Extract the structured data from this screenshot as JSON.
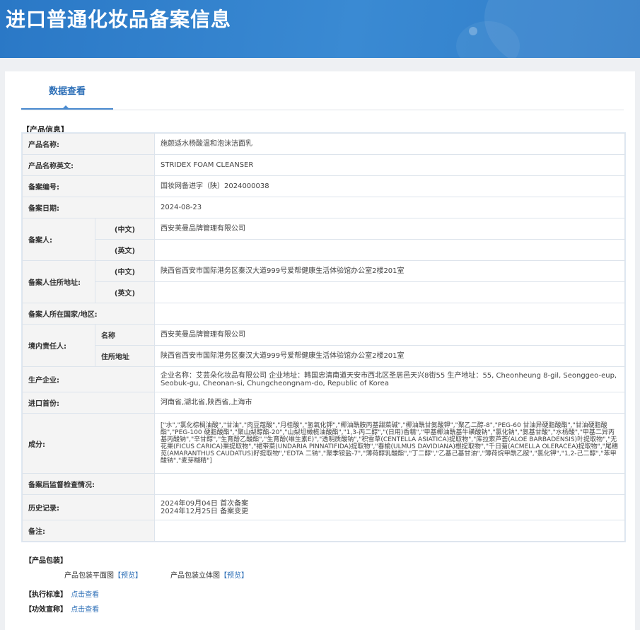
{
  "header": {
    "title": "进口普通化妆品备案信息"
  },
  "tabs": [
    {
      "label": "数据查看"
    }
  ],
  "product_info": {
    "section_title": "【产品信息】",
    "rows": {
      "name": {
        "label": "产品名称:",
        "value": "施颜适水杨酸温和泡沫洁面乳"
      },
      "name_en": {
        "label": "产品名称英文:",
        "value": "STRIDEX FOAM CLEANSER"
      },
      "reg_no": {
        "label": "备案编号:",
        "value": "国妆网备进字（陕）2024000038"
      },
      "reg_date": {
        "label": "备案日期:",
        "value": "2024-08-23"
      },
      "registrant": {
        "label": "备案人:",
        "cn_label": "(中文)",
        "cn_value": "西安芙曼品牌管理有限公司",
        "en_label": "(英文)",
        "en_value": ""
      },
      "registrant_addr": {
        "label": "备案人住所地址:",
        "cn_label": "(中文)",
        "cn_value": "陕西省西安市国际港务区秦汉大道999号爱帮健康生活体验馆办公室2楼201室",
        "en_label": "(英文)",
        "en_value": ""
      },
      "country": {
        "label": "备案人所在国家/地区:",
        "value": ""
      },
      "domestic": {
        "label": "境内责任人:",
        "name_label": "名称",
        "name_value": "西安芙曼品牌管理有限公司",
        "addr_label": "住所地址",
        "addr_value": "陕西省西安市国际港务区秦汉大道999号爱帮健康生活体验馆办公室2楼201室"
      },
      "manufacturer": {
        "label": "生产企业:",
        "value": "企业名称：艾芸朵化妆品有限公司 企业地址：韩国忠清南道天安市西北区圣居邑天兴8街55 生产地址：55, Cheonheung 8-gil, Seonggeo-eup, Seobuk-gu, Cheonan-si, Chungcheongnam-do, Republic of Korea"
      },
      "import_ports": {
        "label": "进口首份:",
        "value": "河南省,湖北省,陕西省,上海市"
      },
      "ingredients": {
        "label": "成分:",
        "value": "[\"水\",\"氯化棕榈油酸\",\"甘油\",\"肉豆蔻酸\",\"月桂酸\",\"氢氧化钾\",\"椰油酰胺丙基甜菜碱\",\"椰油酰甘氨酸钾\",\"聚乙二醇-8\",\"PEG-60 甘油异硬脂酸酯\",\"甘油硬脂酸酯\",\"PEG-100 硬脂酸酯\",\"聚山梨醇酯-20\",\"山梨坦橄榄油酸酯\",\"1,3-丙二醇\",\"(日用)香精\",\"甲基椰油酰基牛磺酸钠\",\"氯化钠\",\"氨基甘酸\",\"水杨酸\",\"甲基二异丙基丙酸钠\",\"辛甘醇\",\"生育酚乙酸酯\",\"生育酚(维生素E)\",\"透明质酸钠\",\"积雪草(CENTELLA ASIATICA)提取物\",\"库拉索芦荟(ALOE BARBADENSIS)叶提取物\",\"无花果(FICUS CARICA)果提取物\",\"裙带菜(UNDARIA PINNATIFIDA)提取物\",\"春榆(ULMUS DAVIDIANA)根提取物\",\"千日菊(ACMELLA OLERACEA)提取物\",\"尾穗苋(AMARANTHUS CAUDATUS)籽提取物\",\"EDTA 二钠\",\"聚季铵盐-7\",\"薄荷醇乳酸酯\",\"丁二醇\",\"乙基己基甘油\",\"薄荷烷甲酰乙胺\",\"氯化钾\",\"1,2-己二醇\",\"苯甲酸钠\",\"麦芽糊精\"]"
      },
      "post_check": {
        "label": "备案后监督检查情况:",
        "value": ""
      },
      "history": {
        "label": "历史记录:",
        "lines": [
          "2024年09月04日 首次备案",
          "2024年12月25日 备案变更"
        ]
      },
      "remarks": {
        "label": "备注:",
        "value": ""
      }
    }
  },
  "packaging": {
    "section_title": "【产品包装】",
    "flat_label": "产品包装平面图",
    "flat_link": "【预览】",
    "3d_label": "产品包装立体图",
    "3d_link": "【预览】"
  },
  "standard": {
    "label": "【执行标准】",
    "link": "点击查看"
  },
  "efficacy": {
    "label": "【功效宣称】",
    "link": "点击查看"
  },
  "colors": {
    "accent": "#2d6fb7",
    "banner": "#2a78c6",
    "label_bg": "#f4f4f4"
  }
}
